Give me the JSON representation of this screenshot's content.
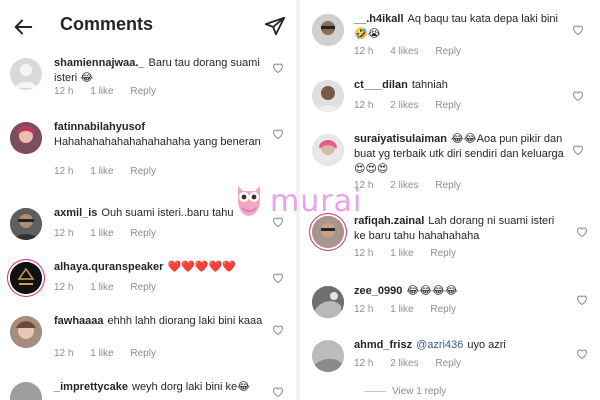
{
  "header": {
    "title": "Comments"
  },
  "left_comments": [
    {
      "username": "shamiennajwaa._",
      "text": "Baru tau dorang suami isteri 😂",
      "time": "12 h",
      "likes": "1 like",
      "reply": "Reply"
    },
    {
      "username": "fatinnabilahyusof",
      "text": "Hahahahahahahahahahaha yang beneran",
      "time": "12 h",
      "likes": "1 like",
      "reply": "Reply"
    },
    {
      "username": "axmil_is",
      "text": "Ouh suami isteri..baru tahu",
      "time": "12 h",
      "likes": "1 like",
      "reply": "Reply"
    },
    {
      "username": "alhaya.quranspeaker",
      "text": "❤️❤️❤️❤️❤️",
      "time": "12 h",
      "likes": "1 like",
      "reply": "Reply"
    },
    {
      "username": "fawhaaaa",
      "text": "ehhh lahh diorang laki bini kaaa",
      "time": "12 h",
      "likes": "1 like",
      "reply": "Reply"
    },
    {
      "username": "_imprettycake",
      "text": "weyh dorg laki bini ke😂",
      "time": "",
      "likes": "",
      "reply": ""
    }
  ],
  "right_comments": [
    {
      "username": "__.h4ikall",
      "text": "Aq baqu tau kata depa laki bini🤣😭",
      "time": "12 h",
      "likes": "4 likes",
      "reply": "Reply"
    },
    {
      "username": "ct___dilan",
      "text": "tahniah",
      "time": "12 h",
      "likes": "2 likes",
      "reply": "Reply"
    },
    {
      "username": "suraiyatisulaiman",
      "text": "😂😂Aoa pun pikir dan buat yg terbaik utk diri sendiri dan keluarga 😍😍😍",
      "time": "12 h",
      "likes": "2 likes",
      "reply": "Reply"
    },
    {
      "username": "rafiqah.zainal",
      "text": "Lah dorang ni suami isteri ke baru tahu hahahahaha",
      "time": "12 h",
      "likes": "1 like",
      "reply": "Reply"
    },
    {
      "username": "zee_0990",
      "text": "😂😂😂😂",
      "time": "12 h",
      "likes": "1 like",
      "reply": "Reply"
    },
    {
      "username": "ahmd_frisz",
      "mention": "@azri436",
      "text": "uyo azri",
      "time": "12 h",
      "likes": "2 likes",
      "reply": "Reply"
    }
  ],
  "view_replies": "View 1 reply",
  "watermark": {
    "text": "murai"
  },
  "icons": {
    "back": "arrow-left-icon",
    "send": "paper-plane-icon",
    "like": "heart-outline-icon"
  },
  "colors": {
    "text": "#262626",
    "meta": "#8e8e8e",
    "mention": "#385898",
    "watermark": "#e493e6"
  }
}
